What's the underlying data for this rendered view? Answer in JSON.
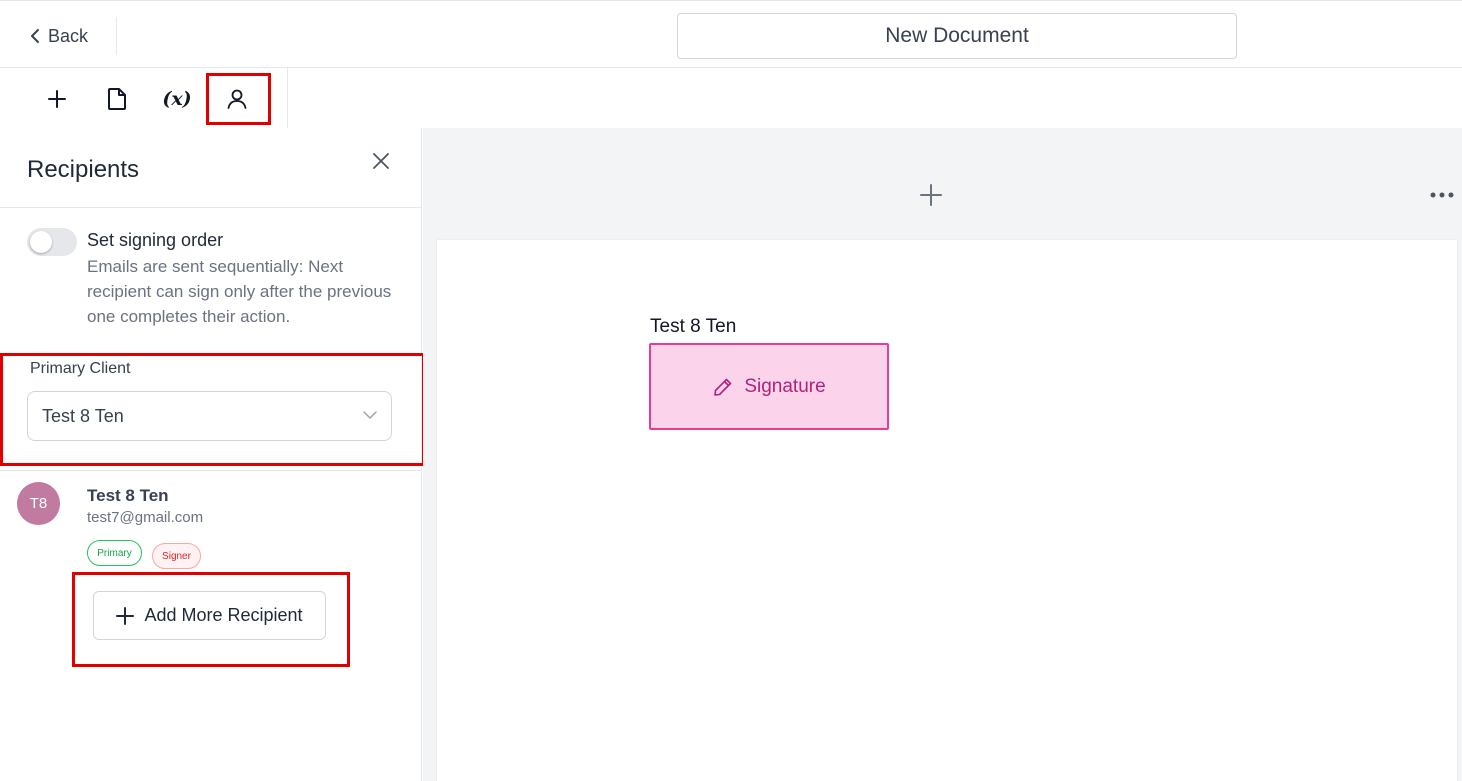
{
  "header": {
    "back_label": "Back",
    "document_title": "New Document"
  },
  "toolbar": {
    "items": [
      {
        "icon": "plus-icon",
        "label": "+"
      },
      {
        "icon": "document-icon"
      },
      {
        "icon": "variable-icon",
        "label": "(x)"
      },
      {
        "icon": "user-icon",
        "selected": true
      }
    ]
  },
  "sidebar": {
    "title": "Recipients",
    "signing_order": {
      "title": "Set signing order",
      "description": "Emails are sent sequentially: Next recipient can sign only after the previous one completes their action.",
      "enabled": false
    },
    "primary_client": {
      "label": "Primary Client",
      "value": "Test 8 Ten"
    },
    "recipients": [
      {
        "initials": "T8",
        "name": "Test 8 Ten",
        "email": "test7@gmail.com",
        "badges": [
          "Primary",
          "Signer"
        ]
      }
    ],
    "add_button_label": "Add More Recipient"
  },
  "canvas": {
    "field_owner": "Test 8 Ten",
    "field_label": "Signature"
  },
  "colors": {
    "highlight": "#e00000",
    "avatar": "#c27ba0",
    "signature_fill": "#fbd3ea",
    "signature_border": "#e23f9b",
    "primary_badge": "#16a34a",
    "signer_badge": "#dc2626"
  }
}
